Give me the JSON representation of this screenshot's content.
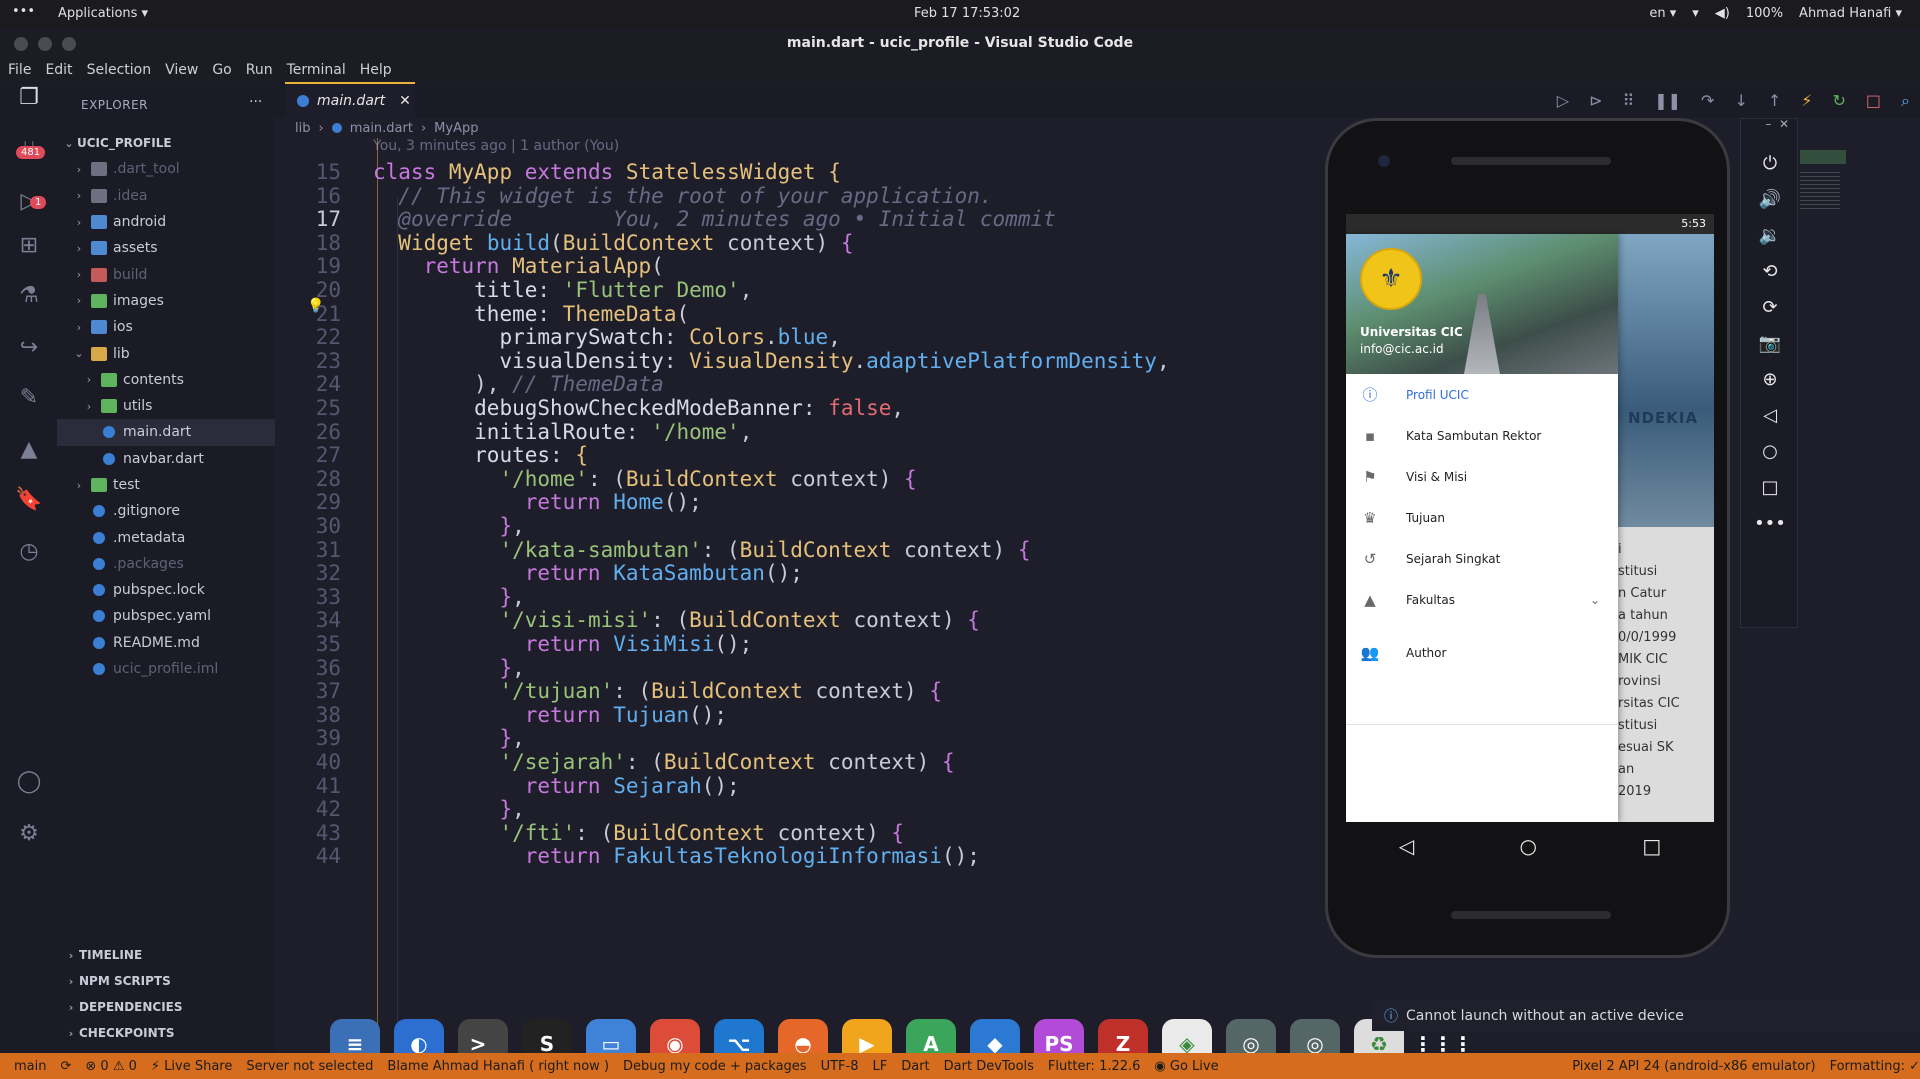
{
  "topbar": {
    "menu": "•••",
    "applications": "Applications ▾",
    "clock": "Feb 17  17:53:02",
    "lang": "en ▾",
    "battery": "100%",
    "user": "Ahmad Hanafi ▾"
  },
  "window": {
    "title": "main.dart - ucic_profile - Visual Studio Code"
  },
  "menubar": [
    "File",
    "Edit",
    "Selection",
    "View",
    "Go",
    "Run",
    "Terminal",
    "Help"
  ],
  "activity": {
    "scm_badge": "481",
    "debug_badge": "1"
  },
  "explorer": {
    "header": "EXPLORER",
    "more": "···",
    "root": "UCIC_PROFILE",
    "items": [
      {
        "label": ".dart_tool",
        "type": "folder",
        "dim": true,
        "chev": "›",
        "indent": 1
      },
      {
        "label": ".idea",
        "type": "folder",
        "dim": true,
        "chev": "›",
        "indent": 1
      },
      {
        "label": "android",
        "type": "folder",
        "dim": false,
        "chev": "›",
        "indent": 1
      },
      {
        "label": "assets",
        "type": "folder",
        "dim": false,
        "chev": "›",
        "indent": 1
      },
      {
        "label": "build",
        "type": "folder",
        "dim": true,
        "chev": "›",
        "indent": 1
      },
      {
        "label": "images",
        "type": "folder",
        "dim": false,
        "chev": "›",
        "indent": 1
      },
      {
        "label": "ios",
        "type": "folder",
        "dim": false,
        "chev": "›",
        "indent": 1
      },
      {
        "label": "lib",
        "type": "folder",
        "dim": false,
        "chev": "⌄",
        "indent": 1
      },
      {
        "label": "contents",
        "type": "folder",
        "dim": false,
        "chev": "›",
        "indent": 2
      },
      {
        "label": "utils",
        "type": "folder",
        "dim": false,
        "chev": "›",
        "indent": 2
      },
      {
        "label": "main.dart",
        "type": "file",
        "dim": false,
        "chev": "",
        "indent": 2,
        "selected": true
      },
      {
        "label": "navbar.dart",
        "type": "file",
        "dim": false,
        "chev": "",
        "indent": 2
      },
      {
        "label": "test",
        "type": "folder",
        "dim": false,
        "chev": "›",
        "indent": 1
      },
      {
        "label": ".gitignore",
        "type": "file",
        "dim": false,
        "chev": "",
        "indent": 1
      },
      {
        "label": ".metadata",
        "type": "file",
        "dim": false,
        "chev": "",
        "indent": 1
      },
      {
        "label": ".packages",
        "type": "file",
        "dim": true,
        "chev": "",
        "indent": 1
      },
      {
        "label": "pubspec.lock",
        "type": "file",
        "dim": false,
        "chev": "",
        "indent": 1
      },
      {
        "label": "pubspec.yaml",
        "type": "file",
        "dim": false,
        "chev": "",
        "indent": 1
      },
      {
        "label": "README.md",
        "type": "file",
        "dim": false,
        "chev": "",
        "indent": 1
      },
      {
        "label": "ucic_profile.iml",
        "type": "file",
        "dim": true,
        "chev": "",
        "indent": 1
      }
    ],
    "sections": [
      "TIMELINE",
      "NPM SCRIPTS",
      "DEPENDENCIES",
      "CHECKPOINTS"
    ]
  },
  "editor": {
    "tab": "main.dart",
    "breadcrumb": [
      "lib",
      "main.dart",
      "MyApp"
    ],
    "blame_header": "You, 3 minutes ago | 1 author (You)",
    "current_line": 17,
    "lines": [
      {
        "n": 15,
        "html": "<span class='k'>class</span> <span class='cls'>MyApp</span> <span class='k'>extends</span> <span class='cls'>StatelessWidget</span> <span class='cls'>{</span>"
      },
      {
        "n": 16,
        "html": "  <span class='cm'>// This widget is the root of your application.</span>"
      },
      {
        "n": 17,
        "html": "  <span class='cm'>@override</span>        <span class='cm'>You, 2 minutes ago • Initial commit</span>"
      },
      {
        "n": 18,
        "html": "  <span class='cls'>Widget</span> <span class='fn'>build</span>(<span class='cls'>BuildContext</span> context) <span class='k'>{</span>"
      },
      {
        "n": 19,
        "html": "    <span class='k'>return</span> <span class='cls'>MaterialApp</span>("
      },
      {
        "n": 20,
        "html": "        <span class='prop'>title</span>: <span class='str'>'Flutter Demo'</span>,"
      },
      {
        "n": 21,
        "html": "        <span class='prop'>theme</span>: <span class='cls'>ThemeData</span>("
      },
      {
        "n": 22,
        "html": "          <span class='prop'>primarySwatch</span>: <span class='cls'>Colors</span>.<span class='fn'>blue</span>,"
      },
      {
        "n": 23,
        "html": "          <span class='prop'>visualDensity</span>: <span class='cls'>VisualDensity</span>.<span class='fn'>adaptivePlatformDensity</span>,"
      },
      {
        "n": 24,
        "html": "        ), <span class='cm'>// ThemeData</span>"
      },
      {
        "n": 25,
        "html": "        <span class='prop'>debugShowCheckedModeBanner</span>: <span class='kw2'>false</span>,"
      },
      {
        "n": 26,
        "html": "        <span class='prop'>initialRoute</span>: <span class='str'>'/home'</span>,"
      },
      {
        "n": 27,
        "html": "        <span class='prop'>routes</span>: <span class='cls'>{</span>"
      },
      {
        "n": 28,
        "html": "          <span class='str'>'/home'</span>: (<span class='cls'>BuildContext</span> context) <span class='k'>{</span>"
      },
      {
        "n": 29,
        "html": "            <span class='k'>return</span> <span class='fn'>Home</span>();"
      },
      {
        "n": 30,
        "html": "          <span class='k'>}</span>,"
      },
      {
        "n": 31,
        "html": "          <span class='str'>'/kata-sambutan'</span>: (<span class='cls'>BuildContext</span> context) <span class='k'>{</span>"
      },
      {
        "n": 32,
        "html": "            <span class='k'>return</span> <span class='fn'>KataSambutan</span>();"
      },
      {
        "n": 33,
        "html": "          <span class='k'>}</span>,"
      },
      {
        "n": 34,
        "html": "          <span class='str'>'/visi-misi'</span>: (<span class='cls'>BuildContext</span> context) <span class='k'>{</span>"
      },
      {
        "n": 35,
        "html": "            <span class='k'>return</span> <span class='fn'>VisiMisi</span>();"
      },
      {
        "n": 36,
        "html": "          <span class='k'>}</span>,"
      },
      {
        "n": 37,
        "html": "          <span class='str'>'/tujuan'</span>: (<span class='cls'>BuildContext</span> context) <span class='k'>{</span>"
      },
      {
        "n": 38,
        "html": "            <span class='k'>return</span> <span class='fn'>Tujuan</span>();"
      },
      {
        "n": 39,
        "html": "          <span class='k'>}</span>,"
      },
      {
        "n": 40,
        "html": "          <span class='str'>'/sejarah'</span>: (<span class='cls'>BuildContext</span> context) <span class='k'>{</span>"
      },
      {
        "n": 41,
        "html": "            <span class='k'>return</span> <span class='fn'>Sejarah</span>();"
      },
      {
        "n": 42,
        "html": "          <span class='k'>}</span>,"
      },
      {
        "n": 43,
        "html": "          <span class='str'>'/fti'</span>: (<span class='cls'>BuildContext</span> context) <span class='k'>{</span>"
      },
      {
        "n": 44,
        "html": "            <span class='k'>return</span> <span class='fn'>FakultasTeknologiInformasi</span>();"
      }
    ]
  },
  "phone": {
    "time": "5:53",
    "drawer_name": "Universitas CIC",
    "drawer_email": "info@cic.ac.id",
    "menu": [
      {
        "label": "Profil UCIC",
        "icon": "ⓘ",
        "active": true
      },
      {
        "label": "Kata Sambutan Rektor",
        "icon": "▪",
        "active": false
      },
      {
        "label": "Visi & Misi",
        "icon": "⚑",
        "active": false
      },
      {
        "label": "Tujuan",
        "icon": "♛",
        "active": false
      },
      {
        "label": "Sejarah Singkat",
        "icon": "↺",
        "active": false
      },
      {
        "label": "Fakultas",
        "icon": "▲",
        "active": false,
        "expand": "⌄"
      },
      {
        "label": "Author",
        "icon": "👥",
        "active": false
      }
    ],
    "bg_heading": "NDEKIA",
    "bg_lines": [
      "i",
      "stitusi",
      "n Catur",
      "a tahun",
      "0/0/1999",
      "MIK CIC",
      "rovinsi",
      "rsitas CIC",
      "stitusi",
      "esuai SK",
      "an",
      "2019"
    ]
  },
  "notice": {
    "text": "Cannot launch without an active device"
  },
  "statusbar": [
    "main",
    "⟳",
    "⊗ 0 ⚠ 0",
    "⚡ Live Share",
    "Server not selected",
    "Blame Ahmad Hanafi ( right now )",
    "Debug my code + packages",
    "UTF-8",
    "LF",
    "Dart",
    "Dart DevTools",
    "Flutter: 1.22.6",
    "◉ Go Live",
    "Pixel 2 API 24 (android-x86 emulator)",
    "Formatting: ✓"
  ],
  "dock": [
    {
      "name": "settings",
      "bg": "#3b6fb6",
      "glyph": "≡"
    },
    {
      "name": "toggle",
      "bg": "#2d6fd0",
      "glyph": "◐"
    },
    {
      "name": "terminal",
      "bg": "#444",
      "glyph": ">_"
    },
    {
      "name": "s-app",
      "bg": "#222",
      "glyph": "S"
    },
    {
      "name": "files",
      "bg": "#3f82d8",
      "glyph": "▭"
    },
    {
      "name": "chrome",
      "bg": "#dd4b39",
      "glyph": "◉"
    },
    {
      "name": "vscode",
      "bg": "#1f77d0",
      "glyph": "⌥"
    },
    {
      "name": "firefox",
      "bg": "#e6672a",
      "glyph": "◓"
    },
    {
      "name": "player",
      "bg": "#f0a51c",
      "glyph": "▶"
    },
    {
      "name": "android-studio",
      "bg": "#3ca55c",
      "glyph": "A"
    },
    {
      "name": "box",
      "bg": "#2b79d3",
      "glyph": "◆"
    },
    {
      "name": "phpstorm",
      "bg": "#b34bd9",
      "glyph": "PS"
    },
    {
      "name": "filezilla",
      "bg": "#c0302a",
      "glyph": "Z"
    },
    {
      "name": "android-sdk",
      "bg": "#eaeaea",
      "glyph": "◈"
    },
    {
      "name": "screenshot",
      "bg": "#566",
      "glyph": "◎"
    },
    {
      "name": "screenshot2",
      "bg": "#566",
      "glyph": "◎"
    },
    {
      "name": "trash",
      "bg": "#ddd",
      "glyph": "♻"
    },
    {
      "name": "grid",
      "bg": "transparent",
      "glyph": "⋮⋮⋮"
    }
  ]
}
